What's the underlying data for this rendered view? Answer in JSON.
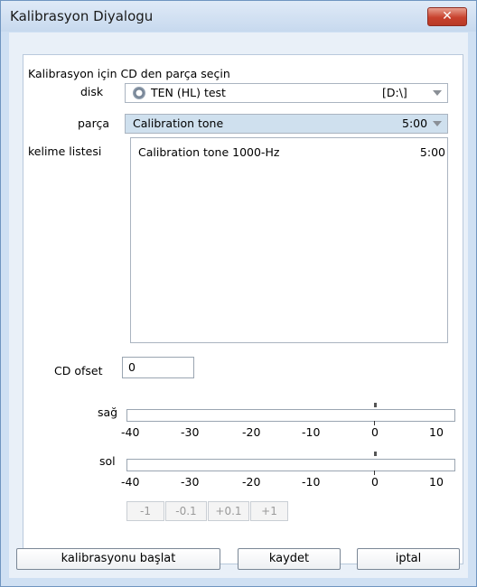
{
  "window": {
    "title": "Kalibrasyon Diyalogu",
    "close_icon": "close-icon"
  },
  "form": {
    "instruction": "Kalibrasyon için CD den  parça seçin",
    "disk_label": "disk",
    "disk_value": "TEN (HL) test",
    "disk_drive": "[D:\\]",
    "parca_label": "parça",
    "parca_value": "Calibration tone",
    "parca_time": "5:00",
    "kelime_label": "kelime listesi",
    "list_items": [
      {
        "name": "Calibration tone 1000-Hz",
        "time": "5:00"
      }
    ],
    "cd_offset_label": "CD ofset",
    "cd_offset_value": "0"
  },
  "meters": {
    "sag_label": "sağ",
    "sol_label": "sol",
    "ticks": [
      "-40",
      "-30",
      "-20",
      "-10",
      "0",
      "10"
    ]
  },
  "adjust_buttons": [
    "-1",
    "-0.1",
    "+0.1",
    "+1"
  ],
  "buttons": {
    "start": "kalibrasyonu başlat",
    "save": "kaydet",
    "cancel": "iptal"
  }
}
